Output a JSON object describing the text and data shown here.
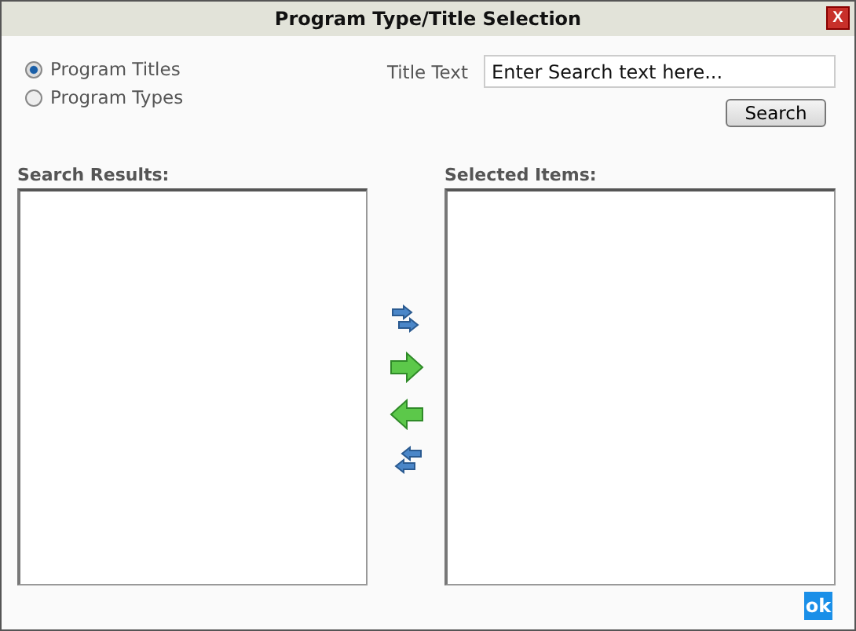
{
  "window": {
    "title": "Program Type/Title Selection",
    "close": "X"
  },
  "mode": [
    {
      "label": "Program Titles",
      "selected": true
    },
    {
      "label": "Program Types",
      "selected": false
    }
  ],
  "search": {
    "label": "Title Text",
    "value": "Enter Search text here...",
    "button": "Search"
  },
  "search_results": {
    "label": "Search Results:"
  },
  "selected_items": {
    "label": "Selected Items:"
  },
  "ok": "ok"
}
